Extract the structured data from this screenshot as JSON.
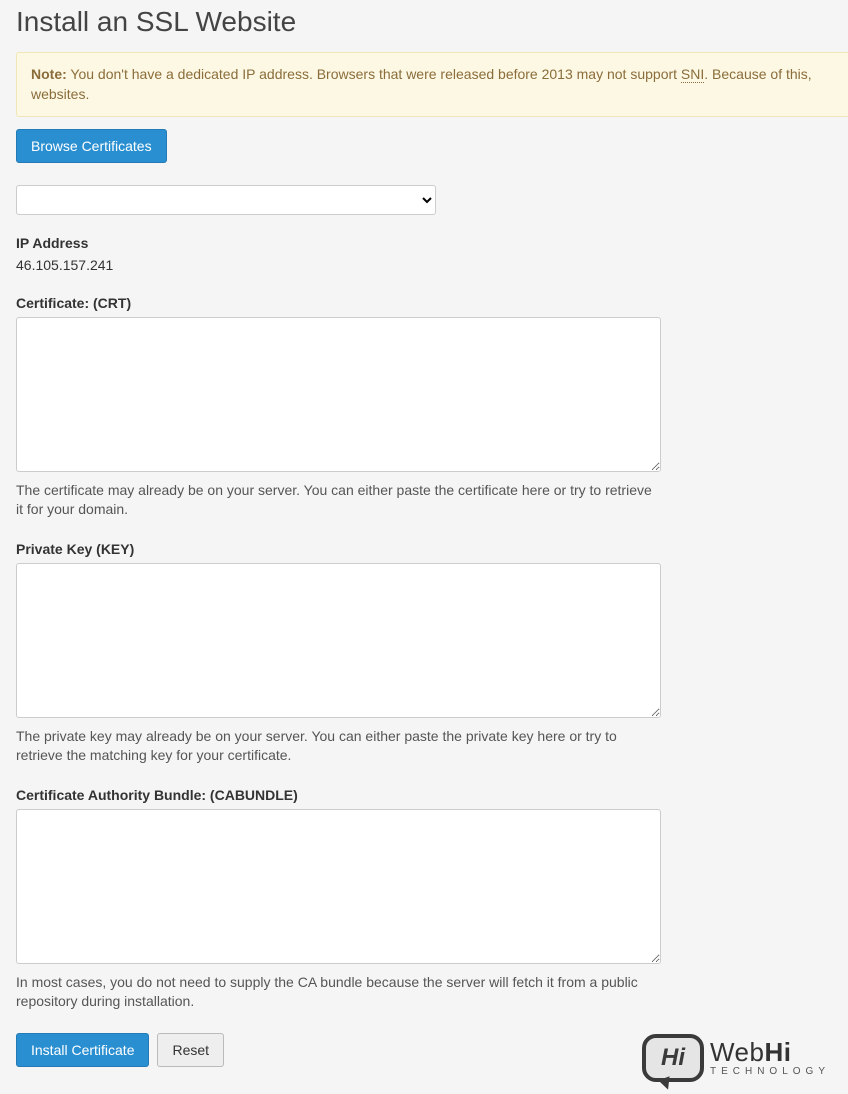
{
  "title": "Install an SSL Website",
  "note": {
    "prefix": "Note:",
    "body_before_sni": " You don't have a dedicated IP address. Browsers that were released before 2013 may not support ",
    "sni": "SNI",
    "body_after_sni": ". Because of this, websites."
  },
  "browse_button": "Browse Certificates",
  "ip": {
    "label": "IP Address",
    "value": "46.105.157.241"
  },
  "crt": {
    "label": "Certificate: (CRT)",
    "value": "",
    "help": "The certificate may already be on your server. You can either paste the certificate here or try to retrieve it for your domain."
  },
  "key": {
    "label": "Private Key (KEY)",
    "value": "",
    "help": "The private key may already be on your server. You can either paste the private key here or try to retrieve the matching key for your certificate."
  },
  "cabundle": {
    "label": "Certificate Authority Bundle: (CABUNDLE)",
    "value": "",
    "help": "In most cases, you do not need to supply the CA bundle because the server will fetch it from a public repository during installation."
  },
  "actions": {
    "install": "Install Certificate",
    "reset": "Reset"
  },
  "logo": {
    "hi": "Hi",
    "brand_plain": "Web",
    "brand_bold": "Hi",
    "sub": "TECHNOLOGY"
  }
}
